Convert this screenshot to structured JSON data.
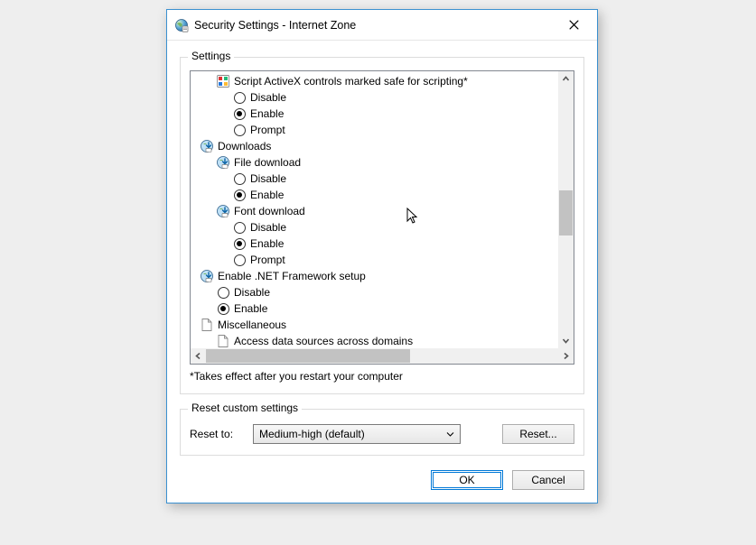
{
  "window": {
    "title": "Security Settings - Internet Zone"
  },
  "settings_group": {
    "legend": "Settings",
    "note": "*Takes effect after you restart your computer",
    "tree": [
      {
        "type": "item",
        "level": 1,
        "icon": "activex",
        "label": "Script ActiveX controls marked safe for scripting*"
      },
      {
        "type": "radio",
        "level": 2,
        "checked": false,
        "label": "Disable"
      },
      {
        "type": "radio",
        "level": 2,
        "checked": true,
        "label": "Enable"
      },
      {
        "type": "radio",
        "level": 2,
        "checked": false,
        "label": "Prompt"
      },
      {
        "type": "category",
        "level": 0,
        "icon": "downloads",
        "label": "Downloads"
      },
      {
        "type": "item",
        "level": 1,
        "icon": "downloads",
        "label": "File download"
      },
      {
        "type": "radio",
        "level": 2,
        "checked": false,
        "label": "Disable"
      },
      {
        "type": "radio",
        "level": 2,
        "checked": true,
        "label": "Enable"
      },
      {
        "type": "item",
        "level": 1,
        "icon": "downloads",
        "label": "Font download"
      },
      {
        "type": "radio",
        "level": 2,
        "checked": false,
        "label": "Disable"
      },
      {
        "type": "radio",
        "level": 2,
        "checked": true,
        "label": "Enable"
      },
      {
        "type": "radio",
        "level": 2,
        "checked": false,
        "label": "Prompt"
      },
      {
        "type": "category",
        "level": 0,
        "icon": "downloads",
        "label": "Enable .NET Framework setup"
      },
      {
        "type": "radio",
        "level": 1,
        "checked": false,
        "label": "Disable"
      },
      {
        "type": "radio",
        "level": 1,
        "checked": true,
        "label": "Enable"
      },
      {
        "type": "category",
        "level": 0,
        "icon": "page",
        "label": "Miscellaneous"
      },
      {
        "type": "item",
        "level": 1,
        "icon": "page",
        "label": "Access data sources across domains"
      }
    ]
  },
  "reset_group": {
    "legend": "Reset custom settings",
    "label": "Reset to:",
    "combo_value": "Medium-high (default)",
    "reset_button": "Reset..."
  },
  "buttons": {
    "ok": "OK",
    "cancel": "Cancel"
  }
}
